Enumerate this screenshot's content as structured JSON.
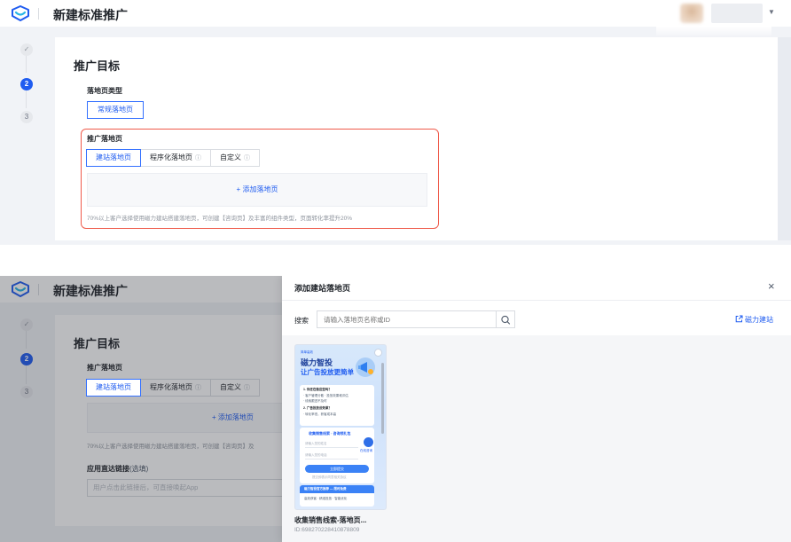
{
  "app": {
    "title": "新建标准推广"
  },
  "colors": {
    "accent": "#1f5cf0",
    "highlight_border": "#ef5a4a",
    "page_bg": "#f1f3f7"
  },
  "steps": [
    {
      "label": "✓",
      "state": "done"
    },
    {
      "label": "2",
      "state": "active"
    },
    {
      "label": "3",
      "state": "pending"
    }
  ],
  "top": {
    "section_title": "推广目标",
    "lp_type": {
      "label": "落地页类型",
      "option": "常规落地页"
    },
    "promo_lp": {
      "label": "推广落地页",
      "tabs": [
        {
          "label": "建站落地页",
          "active": true,
          "help": false
        },
        {
          "label": "程序化落地页",
          "active": false,
          "help": true
        },
        {
          "label": "自定义",
          "active": false,
          "help": true
        }
      ],
      "help_icon": "ⓘ",
      "add_label": "+ 添加落地页",
      "hint": "70%以上客户选择使用磁力建站搭建落地页，可创建【咨询页】及丰富的组件类型，页面转化率提升20%"
    }
  },
  "bottom_bg": {
    "section_title": "推广目标",
    "promo_lp_label": "推广落地页",
    "tabs": [
      "建站落地页",
      "程序化落地页",
      "自定义"
    ],
    "add_label": "+ 添加落地页",
    "hint": "70%以上客户选择使用磁力建站搭建落地页，可创建【咨询页】及",
    "direct_link": {
      "label": "应用直达链接",
      "optional": "(选填)",
      "placeholder": "用户点击此链接后，可直接唤起App"
    }
  },
  "drawer": {
    "title": "添加建站落地页",
    "close_icon": "×",
    "search_label": "搜索",
    "search_placeholder": "请输入落地页名称或ID",
    "site_link": "磁力建站",
    "items": [
      {
        "name": "收集销售线索-落地页...",
        "id": "ID:698270228410878809",
        "preview": {
          "title1": "磁力智投",
          "title2": "让广告投放更简单",
          "tag": "简单高效",
          "q1": "1. 你还在做这些吗？",
          "q1a": "· 客户管理分散 · 投放效果难评估",
          "q1b": "· 线索跟进不及时",
          "q2": "2. 广告投放没效果？",
          "q2a": "· 转化率低，获客成本高",
          "form_title": "收集销售线索 · 咨询领礼包",
          "input1": "请输入您的姓名",
          "input2": "请输入您的电话",
          "submit": "立即提交",
          "footer_note": "提交即表示同意相关协议",
          "banner_title": "磁力智投官方推荐 — 限时免费",
          "banner_sub": "高效获客 · 精准投放 · 智能优化",
          "side_label": "在线咨询"
        }
      }
    ]
  }
}
